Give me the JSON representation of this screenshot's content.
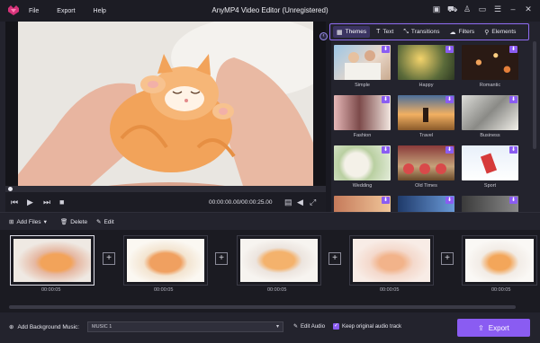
{
  "app": {
    "title": "AnyMP4 Video Editor (Unregistered)",
    "menu": [
      "File",
      "Export",
      "Help"
    ],
    "window_controls": [
      "save-icon",
      "cart-icon",
      "user-icon",
      "feedback-icon",
      "menu-icon",
      "minimize-icon",
      "close-icon"
    ]
  },
  "player": {
    "timecode": "00:00:00.00/00:00:25.00",
    "progress": 0.0
  },
  "tabs": [
    {
      "label": "Themes",
      "icon": "themes-icon",
      "active": true
    },
    {
      "label": "Text",
      "icon": "text-icon",
      "active": false
    },
    {
      "label": "Transitions",
      "icon": "transitions-icon",
      "active": false
    },
    {
      "label": "Filters",
      "icon": "filters-icon",
      "active": false
    },
    {
      "label": "Elements",
      "icon": "elements-icon",
      "active": false
    }
  ],
  "themes": [
    {
      "label": "Simple"
    },
    {
      "label": "Happy"
    },
    {
      "label": "Romantic"
    },
    {
      "label": "Fashion"
    },
    {
      "label": "Travel"
    },
    {
      "label": "Business"
    },
    {
      "label": "Wedding"
    },
    {
      "label": "Old Times"
    },
    {
      "label": "Sport"
    },
    {
      "label": ""
    },
    {
      "label": ""
    },
    {
      "label": ""
    }
  ],
  "toolbar": {
    "add_files": "Add Files",
    "delete": "Delete",
    "edit": "Edit"
  },
  "timeline": {
    "clips": [
      {
        "duration": "00:00:05"
      },
      {
        "duration": "00:00:05"
      },
      {
        "duration": "00:00:05"
      },
      {
        "duration": "00:00:05"
      },
      {
        "duration": "00:00:05"
      }
    ]
  },
  "bottom": {
    "bg_music_label": "Add Background Music:",
    "music_selected": "MUSIC 1",
    "edit_audio": "Edit Audio",
    "keep_original": "Keep original audio track",
    "export": "Export"
  },
  "colors": {
    "accent": "#8a5cf2",
    "background": "#23232d"
  }
}
